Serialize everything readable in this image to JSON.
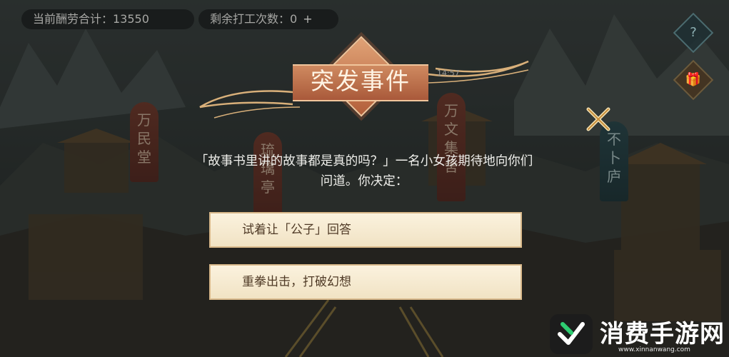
{
  "hud": {
    "salary_label": "当前酬劳合计：13550",
    "work_label": "剩余打工次数：0",
    "plus": "+"
  },
  "side": {
    "help_icon": "question-icon",
    "help_glyph": "?",
    "gift_icon": "gift-icon",
    "gift_glyph": "🎁"
  },
  "event": {
    "title": "突发事件",
    "time": "14:57",
    "question_line1": "「故事书里讲的故事都是真的吗？」一名小女孩期待地向你们",
    "question_line2": "问道。你决定：",
    "options": [
      {
        "label": "试着让「公子」回答"
      },
      {
        "label": "重拳出击，打破幻想"
      }
    ]
  },
  "buildings": {
    "sign1": "万民堂",
    "sign2": "万文集舍",
    "sign3": "不卜庐",
    "sign4": "琉璃亭"
  },
  "watermark": {
    "brand": "消费手游网",
    "url": "www.xinnanwang.com"
  },
  "colors": {
    "banner": "#b35f3a",
    "option_bg": "#f6ead0",
    "option_text": "#4f3a26"
  }
}
